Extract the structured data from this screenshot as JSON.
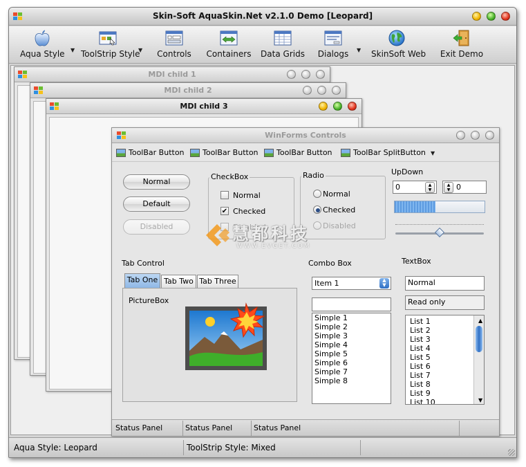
{
  "window": {
    "title": "Skin-Soft AquaSkin.Net v2.1.0 Demo [Leopard]"
  },
  "toolbar": {
    "items": [
      {
        "label": "Aqua Style",
        "icon": "apple-icon",
        "dropdown": true
      },
      {
        "label": "ToolStrip Style",
        "icon": "toolstrip-icon",
        "dropdown": true
      },
      {
        "label": "Controls",
        "icon": "controls-icon",
        "dropdown": false
      },
      {
        "label": "Containers",
        "icon": "containers-icon",
        "dropdown": false
      },
      {
        "label": "Data Grids",
        "icon": "datagrid-icon",
        "dropdown": false
      },
      {
        "label": "Dialogs",
        "icon": "dialogs-icon",
        "dropdown": true
      },
      {
        "label": "SkinSoft Web",
        "icon": "globe-icon",
        "dropdown": false
      },
      {
        "label": "Exit Demo",
        "icon": "exit-door-icon",
        "dropdown": false
      }
    ]
  },
  "mdi": {
    "child1": "MDI child 1",
    "child2": "MDI child 2",
    "child3": "MDI child 3"
  },
  "controls_window": {
    "title": "WinForms Controls",
    "toolstrip": {
      "button1": "ToolBar Button",
      "button2": "ToolBar Button",
      "button3": "ToolBar Button",
      "split": "ToolBar SplitButton"
    },
    "buttons": {
      "normal": "Normal",
      "default": "Default",
      "disabled": "Disabled"
    },
    "checkbox": {
      "group": "CheckBox",
      "normal": "Normal",
      "checked": "Checked",
      "disabled": "Disabled"
    },
    "radio": {
      "group": "Radio",
      "normal": "Normal",
      "checked": "Checked",
      "disabled": "Disabled"
    },
    "updown": {
      "label": "UpDown",
      "left_value": "0",
      "right_value": "0",
      "progress": 0.45,
      "slider": 0.5
    },
    "tabcontrol": {
      "label": "Tab Control",
      "tabs": [
        "Tab One",
        "Tab Two",
        "Tab Three"
      ],
      "picturebox_label": "PictureBox"
    },
    "combobox": {
      "label": "Combo Box",
      "selected": "Item 1",
      "list": [
        "Simple 1",
        "Simple 2",
        "Simple 3",
        "Simple 4",
        "Simple 5",
        "Simple 6",
        "Simple 7",
        "Simple 8"
      ]
    },
    "textbox": {
      "label": "TextBox",
      "normal": "Normal",
      "readonly": "Read only",
      "list": [
        "List 1",
        "List 2",
        "List 3",
        "List 4",
        "List 5",
        "List 6",
        "List 7",
        "List 8",
        "List 9",
        "List 10"
      ]
    },
    "status_panels": [
      "Status Panel",
      "Status Panel",
      "Status Panel"
    ]
  },
  "watermark": {
    "chinese": "慧都科技",
    "latin": "WWW.EVGET.COM"
  },
  "statusbar": {
    "panel1": "Aqua Style: Leopard",
    "panel2": "ToolStrip Style: Mixed"
  }
}
